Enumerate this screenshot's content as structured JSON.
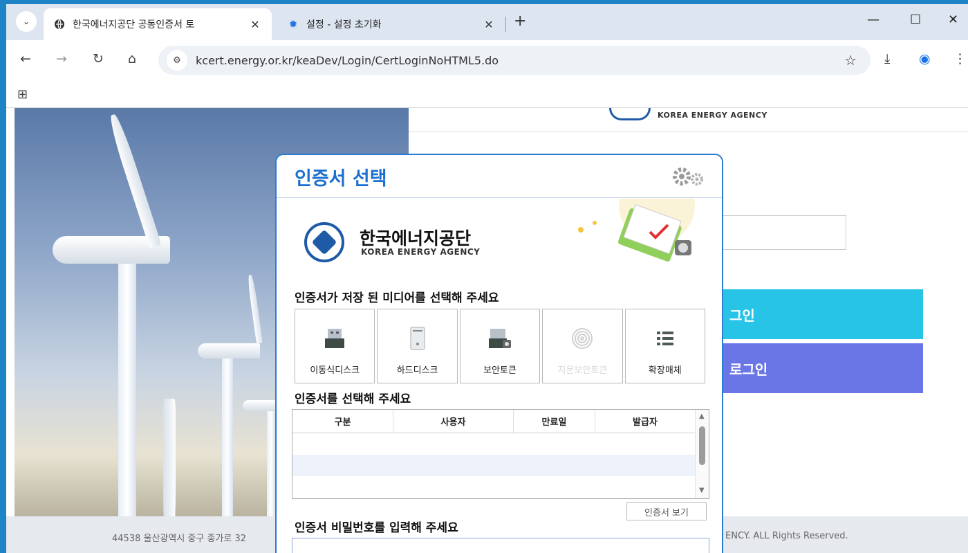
{
  "browser": {
    "tabs": [
      {
        "title": "한국에너지공단 공동인증서 토",
        "icon": "globe-icon",
        "close": "✕"
      },
      {
        "title": "설정 - 설정 초기화",
        "icon": "gear-icon",
        "close": "✕"
      }
    ],
    "new_tab": "+",
    "tab_menu": "⌄",
    "window": {
      "minimize": "—",
      "maximize": "☐",
      "close": "✕"
    },
    "nav": {
      "back": "←",
      "forward": "→",
      "reload": "↻",
      "home": "⌂"
    },
    "url": "kcert.energy.or.kr/keaDev/Login/CertLoginNoHTML5.do",
    "site_info": "⚙",
    "star": "☆",
    "download": "⤓",
    "profile": "◉",
    "menu": "⋮",
    "apps": "⊞"
  },
  "page": {
    "header_agency": "KOREA ENERGY AGENCY",
    "login1": "그인",
    "login2": "로그인",
    "footer_left": "44538 울산광역시 중구 종가로 32",
    "footer_right": "ENCY. ALL Rights Reserved."
  },
  "dialog": {
    "title": "인증서 선택",
    "gear": "⚙",
    "agency_name": "한국에너지공단",
    "agency_eng": "KOREA ENERGY AGENCY",
    "media_prompt": "인증서가 저장 된 미디어를 선택해 주세요",
    "media": [
      {
        "label": "이동식디스크",
        "icon": "usb-drive-icon",
        "glyph": "▬",
        "enabled": true
      },
      {
        "label": "하드디스크",
        "icon": "hard-disk-icon",
        "glyph": "▯",
        "enabled": true
      },
      {
        "label": "보안토큰",
        "icon": "security-token-icon",
        "glyph": "▣",
        "enabled": true
      },
      {
        "label": "지문보안토큰",
        "icon": "fingerprint-icon",
        "glyph": "◎",
        "enabled": false
      },
      {
        "label": "확장매체",
        "icon": "list-icon",
        "glyph": "☰",
        "enabled": true
      }
    ],
    "cert_prompt": "인증서를 선택해 주세요",
    "columns": [
      "구분",
      "사용자",
      "만료일",
      "발급자"
    ],
    "view_cert": "인증서 보기",
    "pw_prompt": "인증서 비밀번호를 입력해 주세요"
  }
}
